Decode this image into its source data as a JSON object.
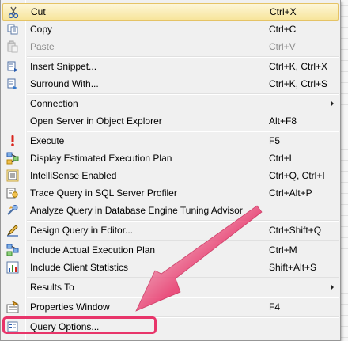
{
  "context_menu": {
    "items": [
      {
        "label": "Cut",
        "shortcut": "Ctrl+X",
        "icon": "scissors-icon"
      },
      {
        "label": "Copy",
        "shortcut": "Ctrl+C",
        "icon": "copy-icon"
      },
      {
        "label": "Paste",
        "shortcut": "Ctrl+V",
        "icon": "paste-icon"
      },
      {
        "label": "Insert Snippet...",
        "shortcut": "Ctrl+K, Ctrl+X",
        "icon": "insert-snippet-icon"
      },
      {
        "label": "Surround With...",
        "shortcut": "Ctrl+K, Ctrl+S",
        "icon": "surround-with-icon"
      },
      {
        "label": "Connection",
        "shortcut": "",
        "icon": ""
      },
      {
        "label": "Open Server in Object Explorer",
        "shortcut": "Alt+F8",
        "icon": ""
      },
      {
        "label": "Execute",
        "shortcut": "F5",
        "icon": "execute-icon"
      },
      {
        "label": "Display Estimated Execution Plan",
        "shortcut": "Ctrl+L",
        "icon": "execution-plan-icon"
      },
      {
        "label": "IntelliSense Enabled",
        "shortcut": "Ctrl+Q, Ctrl+I",
        "icon": "intellisense-icon"
      },
      {
        "label": "Trace Query in SQL Server Profiler",
        "shortcut": "Ctrl+Alt+P",
        "icon": "profiler-icon"
      },
      {
        "label": "Analyze Query in Database Engine Tuning Advisor",
        "shortcut": "",
        "icon": "tuning-advisor-icon"
      },
      {
        "label": "Design Query in Editor...",
        "shortcut": "Ctrl+Shift+Q",
        "icon": "design-query-icon"
      },
      {
        "label": "Include Actual Execution Plan",
        "shortcut": "Ctrl+M",
        "icon": "actual-plan-icon"
      },
      {
        "label": "Include Client Statistics",
        "shortcut": "Shift+Alt+S",
        "icon": "client-statistics-icon"
      },
      {
        "label": "Results To",
        "shortcut": "",
        "icon": ""
      },
      {
        "label": "Properties Window",
        "shortcut": "F4",
        "icon": "properties-icon"
      },
      {
        "label": "Query Options...",
        "shortcut": "",
        "icon": "query-options-icon"
      }
    ]
  },
  "colors": {
    "highlight_border": "#e5c365",
    "callout": "#e8356a",
    "arrow": "#e8356a"
  }
}
